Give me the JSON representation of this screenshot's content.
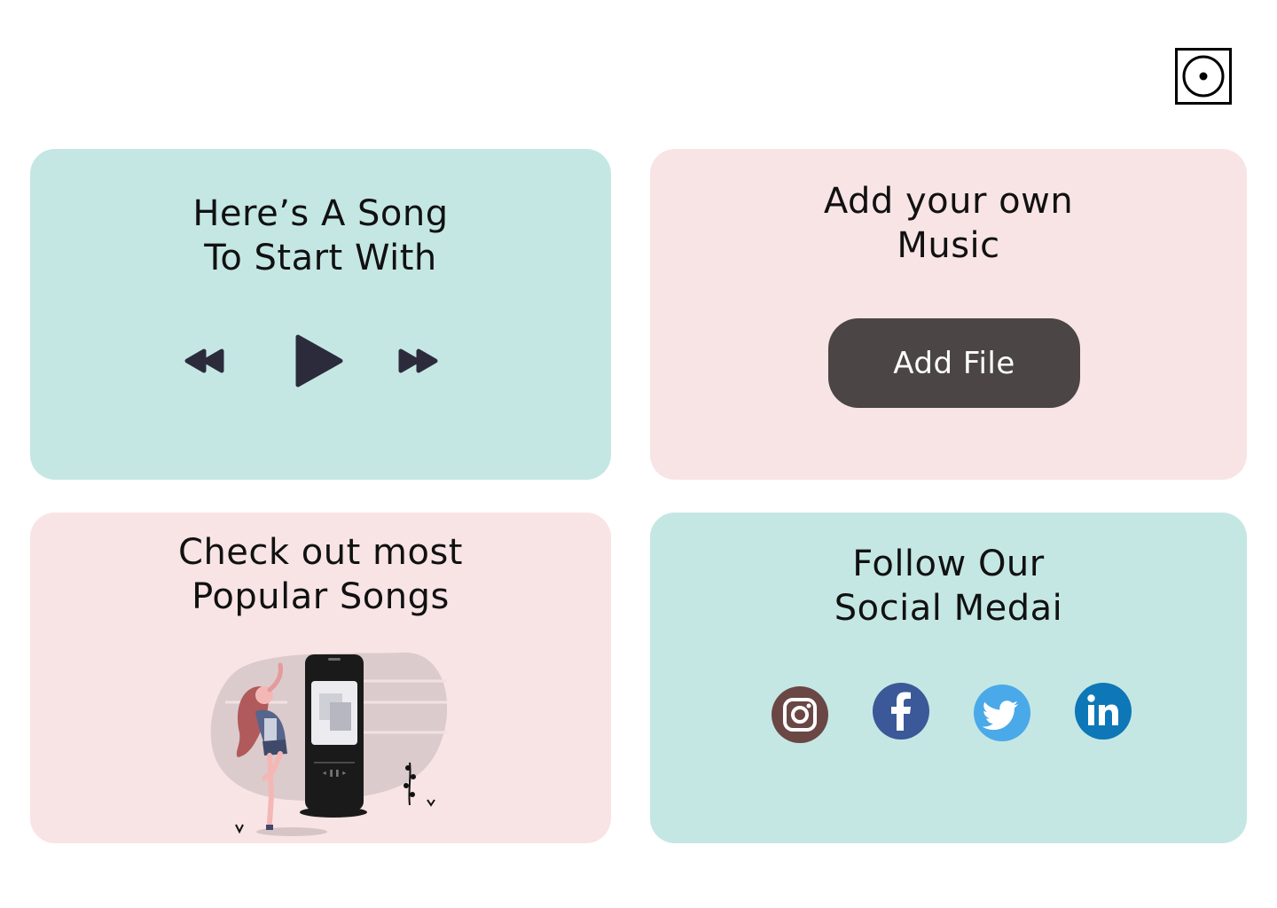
{
  "logo": {
    "icon": "music-disc-icon"
  },
  "cards": {
    "song": {
      "title_line1": "Here’s A Song",
      "title_line2": "To Start With",
      "controls": [
        "rewind-icon",
        "play-icon",
        "fast-forward-icon"
      ]
    },
    "add_music": {
      "title_line1": "Add your own",
      "title_line2": "Music",
      "button_label": "Add File"
    },
    "popular": {
      "title_line1": "Check out most",
      "title_line2": "Popular Songs"
    },
    "social": {
      "title_line1": "Follow Our",
      "title_line2": "Social Medai",
      "networks": [
        {
          "icon": "instagram-icon",
          "color": "#6a4744"
        },
        {
          "icon": "facebook-icon",
          "color": "#3b5998"
        },
        {
          "icon": "twitter-icon",
          "color": "#4aa9e8"
        },
        {
          "icon": "linkedin-icon",
          "color": "#0d77b7"
        }
      ]
    }
  },
  "colors": {
    "teal_card": "#c4e7e4",
    "pink_card": "#f8e4e5",
    "button": "#4b4545",
    "controls": "#2c2b3c"
  }
}
